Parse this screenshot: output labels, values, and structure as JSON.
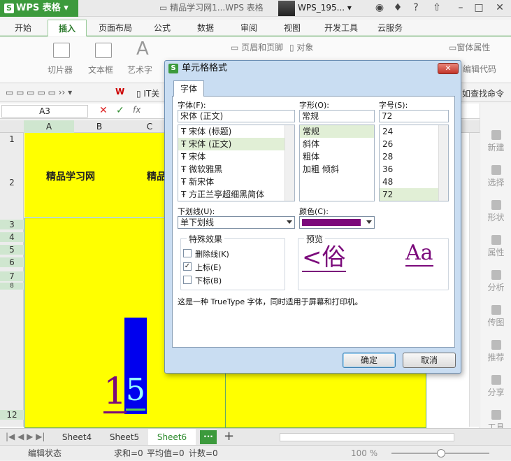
{
  "app": {
    "name": "WPS 表格",
    "doc_title": "精品学习网1...WPS 表格",
    "user": "WPS_195..."
  },
  "menus": [
    "开始",
    "插入",
    "页面布局",
    "公式",
    "数据",
    "审阅",
    "视图",
    "开发工具",
    "云服务"
  ],
  "active_menu": "插入",
  "ribbon": {
    "slicer": "切片器",
    "textbox": "文本框",
    "art": "艺术字",
    "header_footer": "页眉和页脚",
    "object": "对象",
    "window_props": "窗体属性",
    "edit_code": "编辑代码"
  },
  "quickbar": {
    "it_label": "IT关",
    "find_cmd": "查找命令"
  },
  "formula_bar": {
    "name_box": "A3",
    "fx": "fx"
  },
  "sheet": {
    "columns": [
      "A",
      "B",
      "C"
    ],
    "rows": [
      "1",
      "2",
      "3",
      "4",
      "5",
      "6",
      "7",
      "8",
      "12"
    ],
    "cell_a2": "精品学习网",
    "cell_c2": "精品",
    "big_text_1": "1",
    "big_text_5": "5"
  },
  "side_pane": [
    "新建",
    "选择",
    "形状",
    "属性",
    "分析",
    "传图",
    "推荐",
    "分享",
    "工具"
  ],
  "sheet_tabs": [
    "Sheet4",
    "Sheet5",
    "Sheet6"
  ],
  "active_tab": "Sheet6",
  "status": {
    "mode": "编辑状态",
    "sum": "求和=0",
    "avg": "平均值=0",
    "count": "计数=0",
    "zoom": "100 %"
  },
  "dialog": {
    "title": "单元格格式",
    "tab": "字体",
    "font_label": "字体(F):",
    "font_value": "宋体 (正文)",
    "fonts": [
      "宋体 (标题)",
      "宋体 (正文)",
      "宋体",
      "微软雅黑",
      "新宋体",
      "方正兰亭超细黑简体"
    ],
    "selected_font": 1,
    "style_label": "字形(O):",
    "style_value": "常规",
    "styles": [
      "常规",
      "斜体",
      "粗体",
      "加粗 倾斜"
    ],
    "size_label": "字号(S):",
    "size_value": "72",
    "sizes": [
      "24",
      "26",
      "28",
      "36",
      "48",
      "72"
    ],
    "underline_label": "下划线(U):",
    "underline_value": "单下划线",
    "color_label": "颜色(C):",
    "color_value": "#7b0a7b",
    "effects_label": "特殊效果",
    "strike_label": "删除线(K)",
    "super_label": "上标(E)",
    "sub_label": "下标(B)",
    "strike_checked": false,
    "super_checked": true,
    "sub_checked": false,
    "preview_label": "预览",
    "preview_left": "<俗",
    "preview_right": "Aa",
    "info": "这是一种 TrueType 字体，同时适用于屏幕和打印机。",
    "ok": "确定",
    "cancel": "取消"
  }
}
